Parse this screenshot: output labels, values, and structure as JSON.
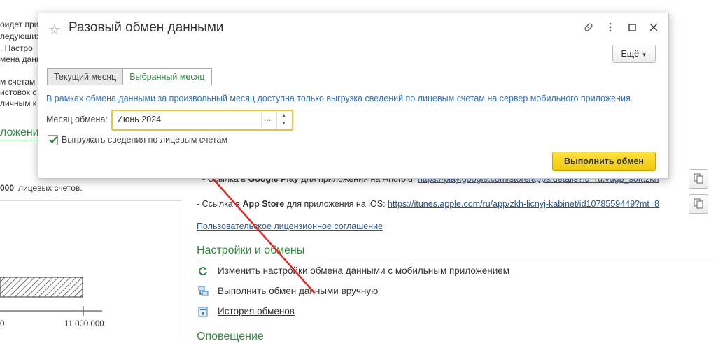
{
  "background": {
    "left_fragments": [
      "ойдет при",
      "ледующих",
      ". Настро",
      "мена данн",
      "м счетам",
      "истовок с",
      "личным к"
    ],
    "section_fragment": "ложени",
    "accounts_count": "000",
    "accounts_suffix": "лицевых счетов.",
    "axis_left": "0",
    "axis_right": "11 000 000",
    "google_prefix": "- Ссылка в",
    "google_store": "Google Play",
    "google_mid": "для приложения на Android:",
    "google_link": "https://play.google.com/store/apps/details?id=ru.vdgb_soft.zkh",
    "appstore_prefix": "- Ссылка в",
    "appstore_store": "App Store",
    "appstore_mid": "для приложения на iOS:",
    "appstore_link": "https://itunes.apple.com/ru/app/zkh-licnyj-kabinet/id1078559449?mt=8",
    "license_link": "Пользовательское лицензионное соглашение",
    "settings_title": "Настройки и обмены",
    "actions": [
      {
        "label": "Изменить настройки обмена данными с мобильным приложением",
        "icon": "refresh-icon"
      },
      {
        "label": "Выполнить обмен данными вручную",
        "icon": "exchange-icon"
      },
      {
        "label": "История обменов",
        "icon": "history-icon"
      }
    ],
    "next_section_fragment": "Оповещение"
  },
  "dialog": {
    "title": "Разовый обмен данными",
    "more_label": "Ещё",
    "tabs": [
      {
        "label": "Текущий месяц",
        "active": true
      },
      {
        "label": "Выбранный месяц",
        "active": false
      }
    ],
    "info_text": "В рамках обмена данными за произвольный месяц доступна только выгрузка сведений по лицевым счетам на сервер мобильного приложения.",
    "month_label": "Месяц обмена:",
    "month_value": "Июнь 2024",
    "month_select": "...",
    "checkbox_label": "Выгружать сведения по лицевым счетам",
    "checkbox_checked": true,
    "execute_label": "Выполнить обмен"
  },
  "colors": {
    "accent_green": "#2e8b3f",
    "link_blue": "#2556a8",
    "info_blue": "#2f72c8",
    "exec_yellow": "#f5d21f",
    "annotation_red": "#e8261d"
  }
}
